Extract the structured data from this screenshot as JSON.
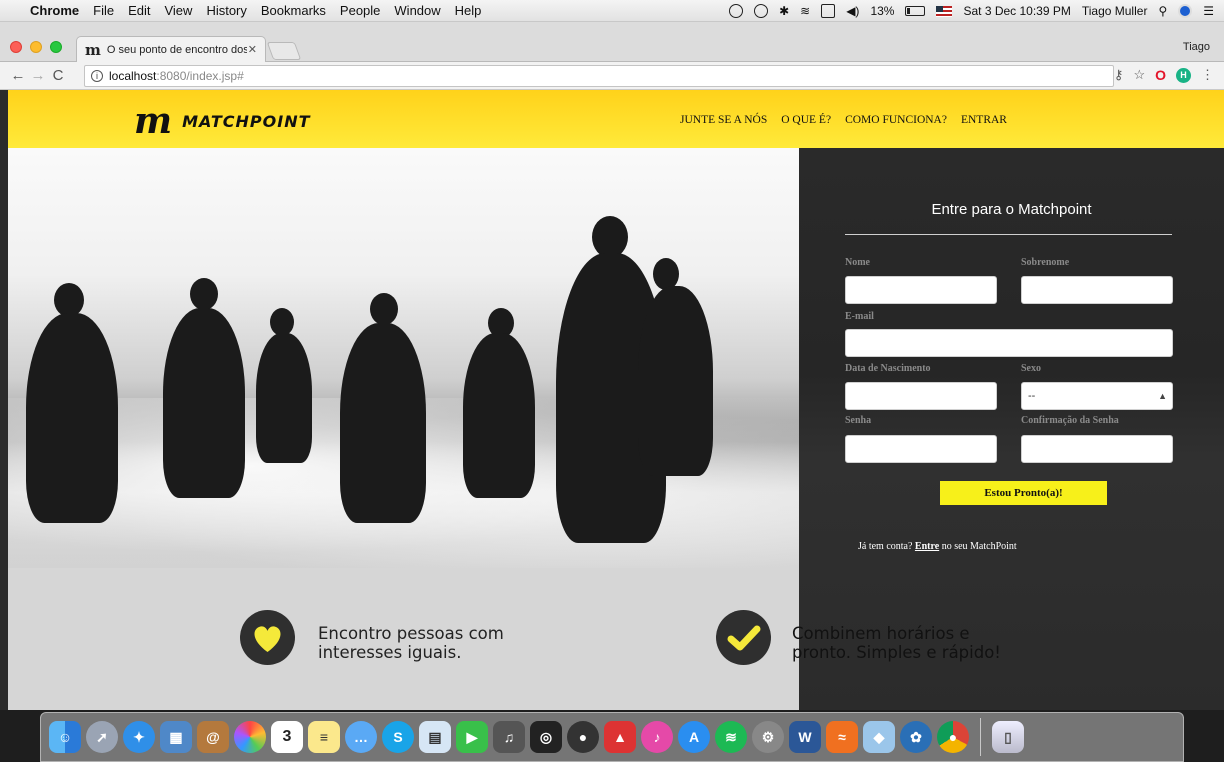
{
  "menubar": {
    "app_name": "Chrome",
    "menus": [
      "File",
      "Edit",
      "View",
      "History",
      "Bookmarks",
      "People",
      "Window",
      "Help"
    ],
    "battery": "13%",
    "datetime": "Sat 3 Dec  10:39 PM",
    "user": "Tiago Muller"
  },
  "browser": {
    "tab_title": "O seu ponto de encontro dos e",
    "profile": "Tiago",
    "url_host": "localhost",
    "url_path": ":8080/index.jsp#"
  },
  "site": {
    "logo_text": "MATCHPOINT",
    "nav": [
      "JUNTE SE A NÓS",
      "O QUE É?",
      "COMO FUNCIONA?",
      "ENTRAR"
    ],
    "colors": {
      "header_yellow": "#ffe02a",
      "panel_dark": "#2b2b2b",
      "button_yellow": "#f7f01a"
    }
  },
  "signup": {
    "title": "Entre para o Matchpoint",
    "labels": {
      "nome": "Nome",
      "sobrenome": "Sobrenome",
      "email": "E-mail",
      "nascimento": "Data de Nascimento",
      "sexo": "Sexo",
      "senha": "Senha",
      "confirmacao": "Confirmação da Senha"
    },
    "sexo_value": "--",
    "submit": "Estou Pronto(a)!",
    "login_prefix": "Já tem conta?",
    "login_link": "Entre",
    "login_suffix": "no seu MatchPoint"
  },
  "features": [
    {
      "icon": "heart-icon",
      "text_line1": "Encontro pessoas com",
      "text_line2": "interesses iguais."
    },
    {
      "icon": "check-icon",
      "text_line1": "Combinem horários e",
      "text_line2": "pronto. Simples e rápido!"
    }
  ],
  "dock": {
    "apps": [
      "finder",
      "launchpad",
      "safari",
      "preview",
      "contacts",
      "photos",
      "calendar",
      "notes",
      "messages",
      "skype",
      "preview-docs",
      "facetime",
      "garageband",
      "photobooth",
      "camera",
      "popcorn-time",
      "itunes",
      "app-store",
      "spotify",
      "system-preferences",
      "word",
      "sublime",
      "virtualbox",
      "sourcetree",
      "chrome",
      "trash"
    ],
    "calendar_day": "3"
  }
}
